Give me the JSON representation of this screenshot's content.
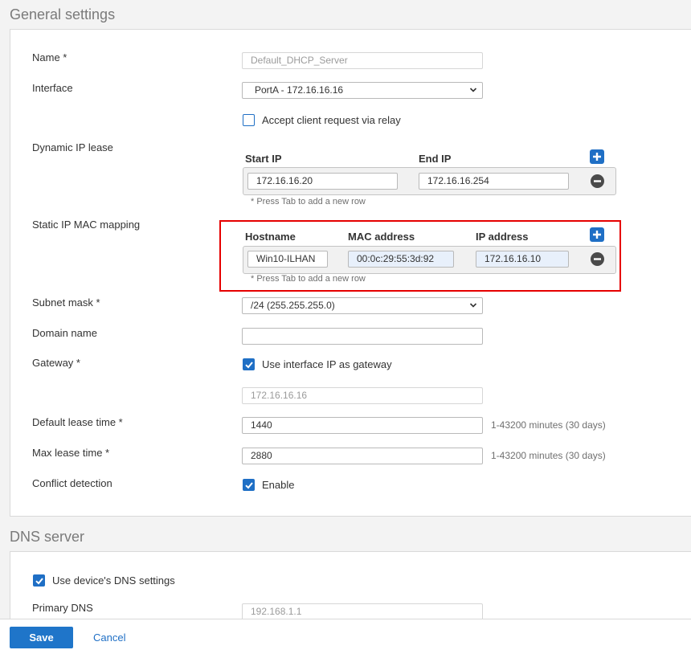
{
  "general": {
    "title": "General settings",
    "name_label": "Name *",
    "name_placeholder": "Default_DHCP_Server",
    "interface_label": "Interface",
    "interface_value": "PortA - 172.16.16.16",
    "relay_label": "Accept client request via relay",
    "relay_checked": false,
    "dynamic_label": "Dynamic IP lease",
    "dynamic": {
      "start_header": "Start IP",
      "end_header": "End IP",
      "start_value": "172.16.16.20",
      "end_value": "172.16.16.254",
      "hint": "* Press Tab to add a new row"
    },
    "static_label": "Static IP MAC mapping",
    "static": {
      "host_header": "Hostname",
      "mac_header": "MAC address",
      "ip_header": "IP address",
      "host_value": "Win10-ILHAN",
      "mac_value": "00:0c:29:55:3d:92",
      "ip_value": "172.16.16.10",
      "hint": "* Press Tab to add a new row"
    },
    "subnet_label": "Subnet mask *",
    "subnet_value": "/24 (255.255.255.0)",
    "domain_label": "Domain name",
    "domain_value": "",
    "gateway_label": "Gateway *",
    "gateway_checkbox_label": "Use interface IP as gateway",
    "gateway_checked": true,
    "gateway_value": "172.16.16.16",
    "default_lease_label": "Default lease time *",
    "default_lease_value": "1440",
    "default_lease_range": "1-43200 minutes (30 days)",
    "max_lease_label": "Max lease time *",
    "max_lease_value": "2880",
    "max_lease_range": "1-43200 minutes (30 days)",
    "conflict_label": "Conflict detection",
    "conflict_checkbox_label": "Enable",
    "conflict_checked": true
  },
  "dns": {
    "title": "DNS server",
    "use_device_label": "Use device's DNS settings",
    "use_device_checked": true,
    "primary_label": "Primary DNS",
    "primary_value": "192.168.1.1"
  },
  "footer": {
    "save_label": "Save",
    "cancel_label": "Cancel"
  },
  "colors": {
    "accent": "#1f6fc5",
    "highlight": "#e60000"
  }
}
